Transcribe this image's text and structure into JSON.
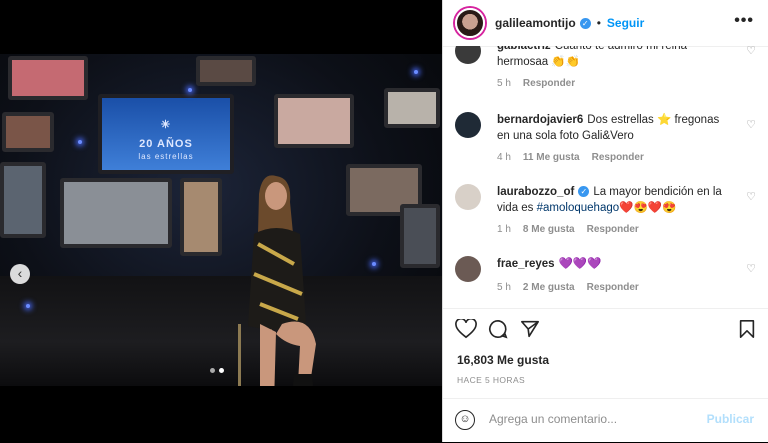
{
  "post": {
    "username": "galileamontijo",
    "separator": "•",
    "follow_label": "Seguir",
    "more_label": "•••",
    "verified_icon": "✓",
    "image": {
      "tv_logo_line1": "20 AÑOS",
      "tv_logo_line2": "las estrellas",
      "carousel_prev": "‹",
      "carousel_count": 2,
      "carousel_active": 2
    },
    "comments": [
      {
        "user": "gabiactriz",
        "text": "Cuanto te admiro mi reina hermosaa 👏👏",
        "time": "5 h",
        "likes": "",
        "reply": "Responder",
        "avatar_color": "#3a3a3a"
      },
      {
        "user": "bernardojavier6",
        "text": "Dos estrellas ⭐️ fregonas en una sola foto Gali&Vero",
        "time": "4 h",
        "likes": "11 Me gusta",
        "reply": "Responder",
        "avatar_color": "#1f2a36"
      },
      {
        "user": "laurabozzo_of",
        "text_before": "La mayor bendición en la vida es ",
        "hashtag": "#amoloquehago",
        "text_after": "❤️😍❤️😍",
        "time": "1 h",
        "likes": "8 Me gusta",
        "reply": "Responder",
        "avatar_color": "#d8d0c8"
      },
      {
        "user": "frae_reyes",
        "text": "💜💜💜",
        "time": "5 h",
        "likes": "2 Me gusta",
        "reply": "Responder",
        "avatar_color": "#6b5a54"
      }
    ],
    "likes_text": "16,803 Me gusta",
    "time_ago": "HACE 5 HORAS",
    "comment_placeholder": "Agrega un comentario...",
    "publish_label": "Publicar",
    "colors": {
      "accent": "#0095f6",
      "verified": "#3897f0",
      "publish_disabled": "#b2dffc"
    }
  }
}
